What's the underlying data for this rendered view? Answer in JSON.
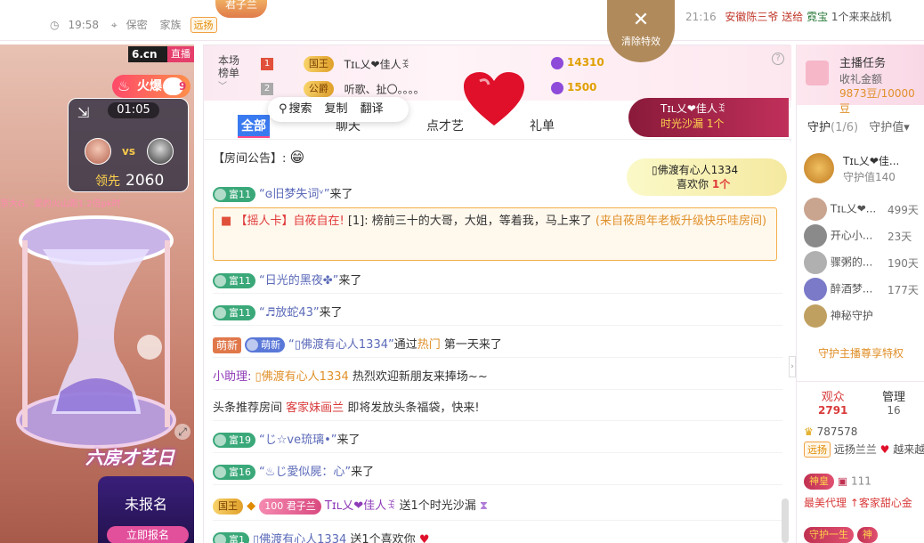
{
  "topbar": {
    "time": "19:58",
    "secret": "保密",
    "family": "家族",
    "family_tag": "远扬",
    "junzilan": "君子兰",
    "ticker_time": "21:16",
    "ticker_user": "安徽陈三爷 送给",
    "ticker_target": "霓宝",
    "ticker_gift": "1个来来战机"
  },
  "video": {
    "site": "6.cn",
    "live": "直播",
    "hot_label": "火爆",
    "hot_level": "9",
    "pk_time": "01:05",
    "vs": "vs",
    "lead_label": "领先",
    "lead_score": "2060",
    "marquee": "京大G、爱的火山跑1.2倍pk时",
    "banner": "六房才艺日",
    "signup": "未报名",
    "signup_more": "立即报名"
  },
  "rank": {
    "label_line1": "本场",
    "label_line2": "榜单",
    "rows": [
      {
        "no": "1",
        "badge": "国王",
        "name": "Tɪʟ乂❤佳人ꉂ",
        "score": "14310"
      },
      {
        "no": "2",
        "badge": "公爵",
        "name": "听歌、扯〇。。。。",
        "score": "1500"
      }
    ],
    "help": "?"
  },
  "popup": {
    "search": "搜索",
    "copy": "复制",
    "translate": "翻译"
  },
  "tabs": [
    "全部",
    "聊天",
    "点才艺",
    "礼单"
  ],
  "chat": {
    "announce": "【房间公告】:",
    "m1_lv": "富11",
    "m1_name": "“ɞ旧梦失词ᵛ”",
    "m1_suffix": "来了",
    "notice_card": "【摇人卡】",
    "notice_user": "自莜自在!",
    "notice_text": "[1]: 榜前三十的大哥，大姐，等着我，马上来了",
    "notice_from": "(来自莜周年老板升级快乐哇房间)",
    "m2_lv": "富11",
    "m2_name": "“日光的黑夜✤”",
    "m2_suffix": "来了",
    "m3_lv": "富11",
    "m3_name": "“♬放蛇43”",
    "m3_suffix": "来了",
    "m4_tag": "萌新",
    "m4_lv": "萌新",
    "m4_name": "“▯佛渡有心人1334”",
    "m4_via": "通过",
    "m4_hot": "热门",
    "m4_suffix": "第一天来了",
    "m5_prefix": "小助理:",
    "m5_name": "▯佛渡有心人1334",
    "m5_text": "热烈欢迎新朋友来捧场~~",
    "m6_prefix": "头条推荐房间",
    "m6_room": "客家妹画兰",
    "m6_text": "即将发放头条福袋，快来!",
    "m7_lv": "富19",
    "m7_name": "“じ☆ve琉璃•”",
    "m7_suffix": "来了",
    "m8_lv": "富16",
    "m8_name": "“♨じ愛似屍：心”",
    "m8_suffix": "来了",
    "m9_king": "国王",
    "m9_jzl_lv": "100",
    "m9_jzl": "君子兰",
    "m9_name": "Tɪʟ乂❤佳人ꉂ",
    "m9_text": "送1个时光沙漏",
    "m10_lv": "富1",
    "m10_name": "▯佛渡有心人1334",
    "m10_text": "送1个喜欢你"
  },
  "overlay": {
    "clear_effects": "清除特效",
    "gift_user": "Tɪʟ乂❤佳人ꉂ",
    "gift_name": "时光沙漏",
    "gift_count": "1个",
    "like_user": "▯佛渡有心人1334",
    "like_gift": "喜欢你",
    "like_count": "1个"
  },
  "right": {
    "task_title": "主播任务",
    "task_sub": "收礼金额",
    "task_progress": "9873豆/10000豆",
    "guard_tab": "守护",
    "guard_count": "(1/6)",
    "guard_value_tab": "守护值▾",
    "top_guard_name": "Tɪʟ乂❤佳...",
    "top_guard_value": "守护值140",
    "guards": [
      {
        "name": "Tɪʟ乂❤...",
        "days": "499天"
      },
      {
        "name": "开心小...",
        "days": "23天"
      },
      {
        "name": "骤粥的...",
        "days": "190天"
      },
      {
        "name": "醉酒梦...",
        "days": "177天"
      },
      {
        "name": "神秘守护",
        "days": ""
      }
    ],
    "guard_link": "守护主播尊享特权",
    "audience_label": "观众",
    "audience_count": "2791",
    "manage_label": "管理",
    "manage_count": "16",
    "a1": "787578",
    "a2_tag": "远扬",
    "a2_text": "远扬兰兰",
    "a2_more": "越来越",
    "a3_badge": "神皇",
    "a3_num": "111",
    "a4": "最美代理",
    "a4_more": "↑客家甜心金",
    "a5_badge": "守护一生",
    "a5_more": "神"
  }
}
